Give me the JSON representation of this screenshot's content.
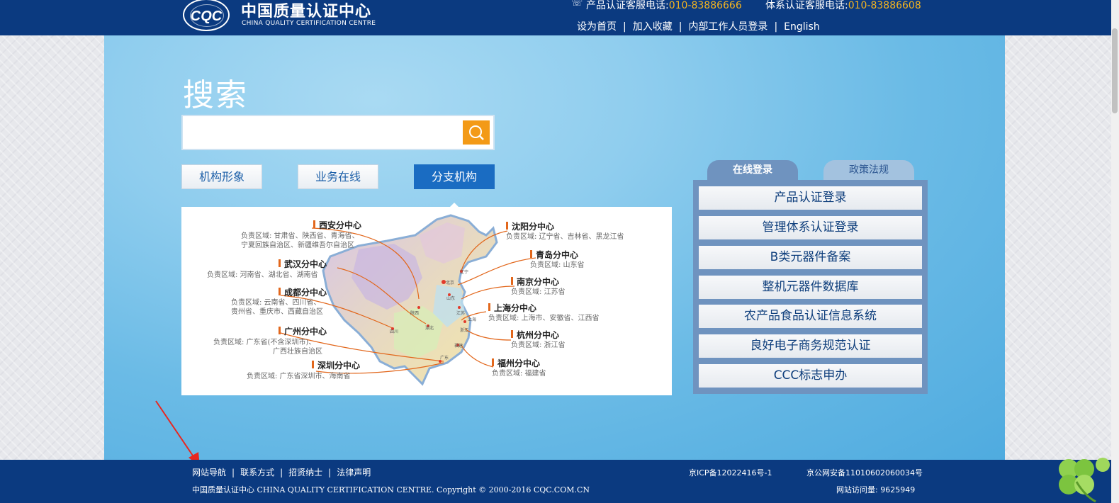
{
  "header": {
    "logo_text": "CQC",
    "org_name_cn": "中国质量认证中心",
    "org_name_en": "CHINA QUALITY CERTIFICATION CENTRE",
    "product_hotline_label": "产品认证客服电话:",
    "product_hotline_number": "010-83886666",
    "system_hotline_label": "体系认证客服电话:",
    "system_hotline_number": "010-83886608",
    "links": [
      "设为首页",
      "加入收藏",
      "内部工作人员登录",
      "English"
    ]
  },
  "search": {
    "title": "搜索",
    "placeholder": ""
  },
  "tabs": [
    "机构形象",
    "业务在线",
    "分支机构"
  ],
  "branches": [
    {
      "name": "西安分中心",
      "area1": "负责区域: 甘肃省、陕西省、青海省、",
      "area2": "宁夏回族自治区、新疆维吾尔自治区"
    },
    {
      "name": "武汉分中心",
      "area1": "负责区域: 河南省、湖北省、湖南省",
      "area2": ""
    },
    {
      "name": "成都分中心",
      "area1": "负责区域: 云南省、四川省、",
      "area2": "贵州省、重庆市、西藏自治区"
    },
    {
      "name": "广州分中心",
      "area1": "负责区域: 广东省(不含深圳市)、",
      "area2": "广西壮族自治区"
    },
    {
      "name": "深圳分中心",
      "area1": "负责区域: 广东省深圳市、海南省",
      "area2": ""
    },
    {
      "name": "沈阳分中心",
      "area1": "负责区域: 辽宁省、吉林省、黑龙江省",
      "area2": ""
    },
    {
      "name": "青岛分中心",
      "area1": "负责区域: 山东省",
      "area2": ""
    },
    {
      "name": "南京分中心",
      "area1": "负责区域: 江苏省",
      "area2": ""
    },
    {
      "name": "上海分中心",
      "area1": "负责区域: 上海市、安徽省、江西省",
      "area2": ""
    },
    {
      "name": "杭州分中心",
      "area1": "负责区域: 浙江省",
      "area2": ""
    },
    {
      "name": "福州分中心",
      "area1": "负责区域: 福建省",
      "area2": ""
    }
  ],
  "map_labels": {
    "beijing": "北京",
    "liaoning": "辽宁",
    "shandong": "山东",
    "shaanxi": "陕西",
    "hubei": "湖北",
    "sichuan": "四川",
    "jiangsu": "江苏",
    "shanghai": "上海",
    "zhejiang": "浙江",
    "fujian": "福建",
    "guangdong": "广东"
  },
  "panel": {
    "tab_active": "在线登录",
    "tab_inactive": "政策法规",
    "items": [
      "产品认证登录",
      "管理体系认证登录",
      "B类元器件备案",
      "整机元器件数据库",
      "农产品食品认证信息系统",
      "良好电子商务规范认证",
      "CCC标志申办"
    ]
  },
  "footer": {
    "links": [
      "网站导航",
      "联系方式",
      "招贤纳士",
      "法律声明"
    ],
    "copyright": "中国质量认证中心 CHINA QUALITY CERTIFICATION CENTRE. Copyright © 2000-2016 CQC.COM.CN",
    "icp": "京ICP备12022416号-1",
    "gongan": "京公网安备11010602060034号",
    "visits": "网站访问量: 9625949"
  },
  "colors": {
    "header_bg": "#0b3a80",
    "accent": "#f39a17",
    "hotline": "#f6b51e",
    "annotation": "#e8261f"
  }
}
